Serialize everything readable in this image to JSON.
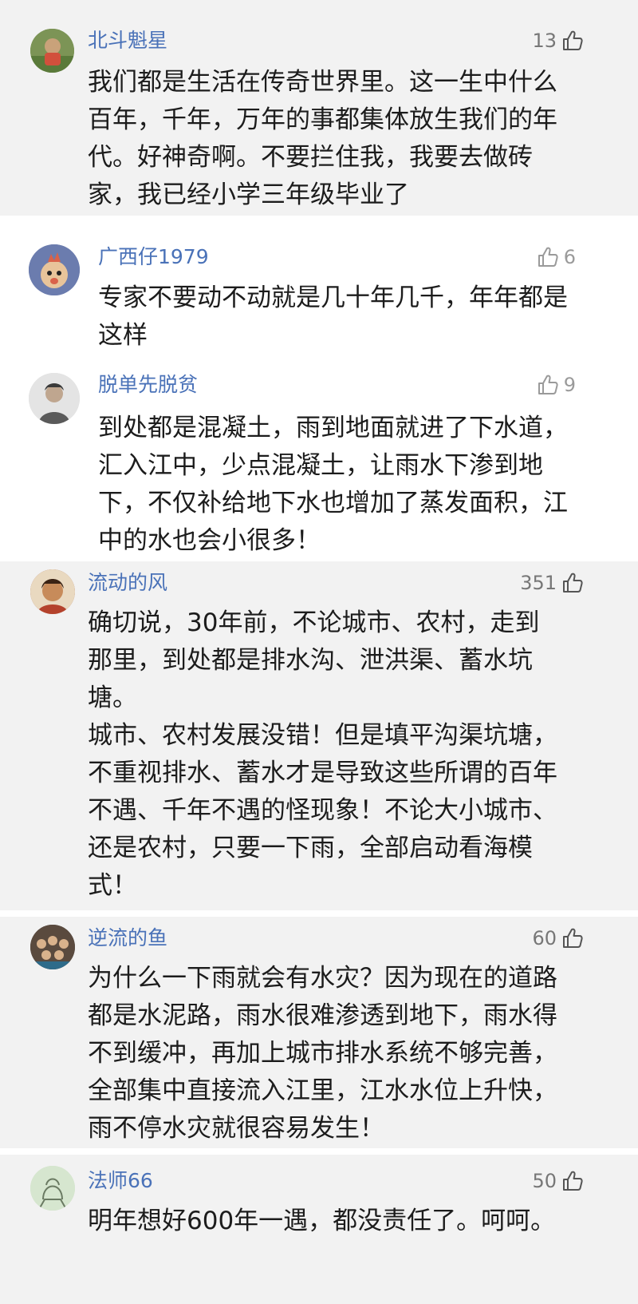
{
  "comments": [
    {
      "user": "北斗魁星",
      "likes": "13",
      "avatar": "photo-avatar-child",
      "lines": [
        "我们都是生活在传奇世界里。这一生中什么",
        "百年，千年，万年的事都集体放生我们的年",
        "代。好神奇啊。不要拦住我，我要去做砖",
        "家，我已经小学三年级毕业了"
      ]
    },
    {
      "user": "广西仔1979",
      "likes": "6",
      "avatar": "cartoon-avatar",
      "lines": [
        "专家不要动不动就是几十年几千，年年都是",
        "这样"
      ]
    },
    {
      "user": "脱单先脱贫",
      "likes": "9",
      "avatar": "photo-avatar-person",
      "lines": [
        "到处都是混凝土，雨到地面就进了下水道，",
        "汇入江中，少点混凝土，让雨水下渗到地",
        "下，不仅补给地下水也增加了蒸发面积，江",
        "中的水也会小很多！"
      ]
    },
    {
      "user": "流动的风",
      "likes": "351",
      "avatar": "photo-avatar-child",
      "lines": [
        "确切说，30年前，不论城市、农村，走到",
        "那里，到处都是排水沟、泄洪渠、蓄水坑",
        "塘。",
        "城市、农村发展没错！但是填平沟渠坑塘，",
        "不重视排水、蓄水才是导致这些所谓的百年",
        "不遇、千年不遇的怪现象！不论大小城市、",
        "还是农村，只要一下雨，全部启动看海模",
        "式！"
      ]
    },
    {
      "user": "逆流的鱼",
      "likes": "60",
      "avatar": "photo-avatar-group",
      "lines": [
        "为什么一下雨就会有水灾？因为现在的道路",
        "都是水泥路，雨水很难渗透到地下，雨水得",
        "不到缓冲，再加上城市排水系统不够完善，",
        "全部集中直接流入江里，江水水位上升快，",
        "雨不停水灾就很容易发生！"
      ]
    },
    {
      "user": "法师66",
      "likes": "50",
      "avatar": "sketch-avatar",
      "lines": [
        "明年想好600年一遇，都没责任了。呵呵。"
      ]
    }
  ],
  "colors": {
    "username": "#4a72b8",
    "card_gray": "#f2f2f2",
    "card_white": "#ffffff",
    "like_count": "#777777"
  },
  "icons": [
    "thumbs-up-icon"
  ]
}
